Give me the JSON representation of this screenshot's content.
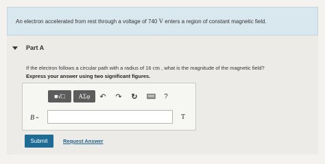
{
  "problem": {
    "intro_before": "An electron accelerated from rest through a voltage of 740 ",
    "intro_unit": "V",
    "intro_after": " enters a region of constant magnetic field."
  },
  "part": {
    "title": "Part A",
    "question_before": "If the electron follows a circular path with a radius of 16 ",
    "question_unit": "cm",
    "question_after": " , what is the magnitude of the magnetic field?",
    "instruction": "Express your answer using two significant figures."
  },
  "toolbar": {
    "templates_label": "■√□",
    "symbols_label": "ΑΣφ",
    "undo_glyph": "↶",
    "redo_glyph": "↷",
    "reset_glyph": "↻",
    "help_glyph": "?"
  },
  "answer": {
    "variable": "B",
    "equals": " =",
    "value": "",
    "unit": "T"
  },
  "actions": {
    "submit_label": "Submit",
    "request_answer_label": "Request Answer"
  }
}
